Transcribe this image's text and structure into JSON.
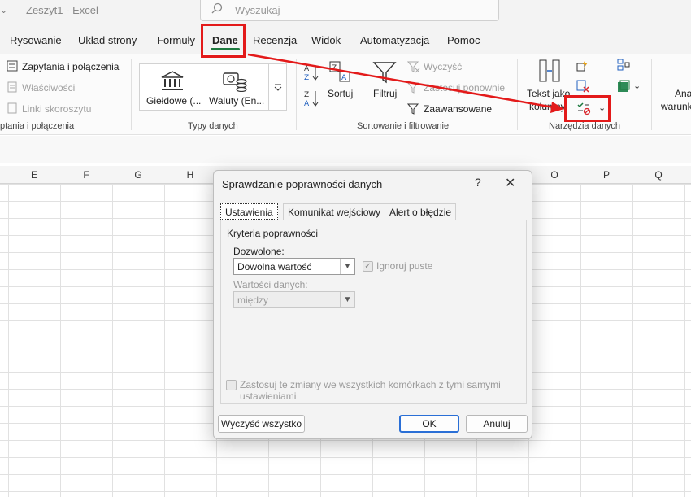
{
  "window": {
    "title": "Zeszyt1 - Excel",
    "search_placeholder": "Wyszukaj"
  },
  "tabs": [
    {
      "label": "Rysowanie"
    },
    {
      "label": "Układ strony"
    },
    {
      "label": "Formuły"
    },
    {
      "label": "Dane",
      "active": true
    },
    {
      "label": "Recenzja"
    },
    {
      "label": "Widok"
    },
    {
      "label": "Automatyzacja"
    },
    {
      "label": "Pomoc"
    }
  ],
  "ribbon": {
    "queries": {
      "queries_connections": "Zapytania i połączenia",
      "properties": "Właściwości",
      "edit_links": "Linki skoroszytu",
      "group_label": "ptania i połączenia"
    },
    "data_types": {
      "stocks": "Giełdowe (...",
      "currencies": "Waluty (En...",
      "group_label": "Typy danych"
    },
    "sort_filter": {
      "sort": "Sortuj",
      "filter": "Filtruj",
      "clear": "Wyczyść",
      "reapply": "Zastosuj ponownie",
      "advanced": "Zaawansowane",
      "group_label": "Sortowanie i filtrowanie"
    },
    "data_tools": {
      "text_to_columns_1": "Tekst jako",
      "text_to_columns_2": "kolumny",
      "group_label": "Narzędzia danych"
    },
    "analysis": {
      "label_1": "Ana",
      "label_2": "warunk"
    }
  },
  "columns": [
    "E",
    "F",
    "G",
    "H",
    "O",
    "P",
    "Q"
  ],
  "dialog": {
    "title": "Sprawdzanie poprawności danych",
    "help": "?",
    "close": "✕",
    "tabs": [
      "Ustawienia",
      "Komunikat wejściowy",
      "Alert o błędzie"
    ],
    "criteria_label": "Kryteria poprawności",
    "allow_label": "Dozwolone:",
    "allow_value": "Dowolna wartość",
    "ignore_blank": "Ignoruj puste",
    "data_label": "Wartości danych:",
    "data_value": "między",
    "apply_all": "Zastosuj te zmiany we wszystkich komórkach z tymi samymi ustawieniami",
    "clear_all": "Wyczyść wszystko",
    "ok": "OK",
    "cancel": "Anuluj"
  },
  "colors": {
    "accent_green": "#1d7a3f",
    "annotation_red": "#e31a1a",
    "primary_blue": "#2a6fd6"
  }
}
